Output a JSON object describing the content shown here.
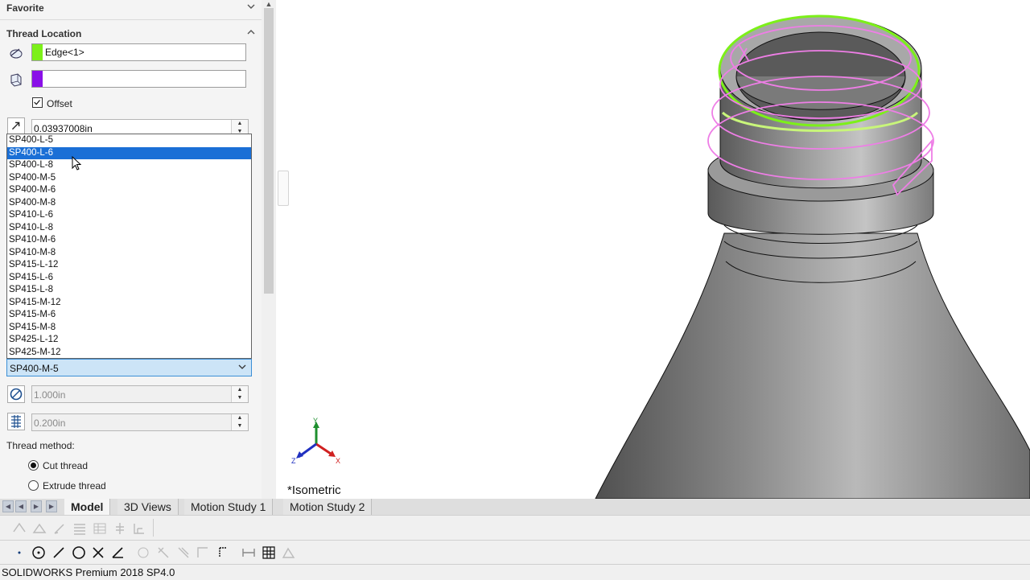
{
  "panel": {
    "favorite_label": "Favorite",
    "thread_location_label": "Thread Location",
    "edge_value": "Edge<1>",
    "face_value": "",
    "offset_label": "Offset",
    "offset_checked": true,
    "offset_value": "0.03937008in",
    "dropdown": {
      "options": [
        "SP400-L-5",
        "SP400-L-6",
        "SP400-L-8",
        "SP400-M-5",
        "SP400-M-6",
        "SP400-M-8",
        "SP410-L-6",
        "SP410-L-8",
        "SP410-M-6",
        "SP410-M-8",
        "SP415-L-12",
        "SP415-L-6",
        "SP415-L-8",
        "SP415-M-12",
        "SP415-M-6",
        "SP415-M-8",
        "SP425-L-12",
        "SP425-M-12"
      ],
      "highlighted": "SP400-L-6",
      "selected": "SP400-M-5"
    },
    "diameter_value": "1.000in",
    "pitch_value": "0.200in",
    "thread_method_label": "Thread method:",
    "cut_thread_label": "Cut thread",
    "extrude_thread_label": "Extrude thread",
    "thread_method_selected": "Cut thread"
  },
  "viewport": {
    "view_label": "*Isometric",
    "triad_labels": {
      "x": "X",
      "y": "Y",
      "z": "Z"
    }
  },
  "tabs": [
    {
      "label": "Model",
      "active": true
    },
    {
      "label": "3D Views",
      "active": false
    },
    {
      "label": "Motion Study 1",
      "active": false
    },
    {
      "label": "Motion Study 2",
      "active": false
    }
  ],
  "status_bar": {
    "text": "SOLIDWORKS Premium 2018 SP4.0"
  },
  "colors": {
    "edge_swatch": "#7cf019",
    "face_swatch": "#8a10e8",
    "thread_helix": "#ee7ee6",
    "selection_highlight": "#1a6fd6"
  }
}
